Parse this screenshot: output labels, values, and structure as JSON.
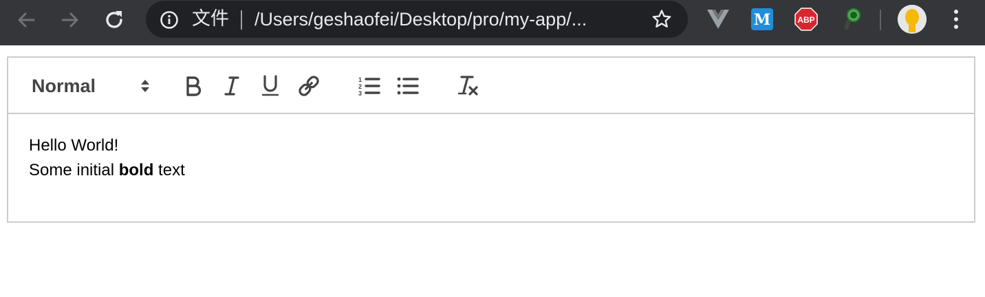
{
  "browser": {
    "page_label": "文件",
    "url": "/Users/geshaofei/Desktop/pro/my-app/...",
    "colors": {
      "toolbar": "#35363a",
      "omnibox": "#202124",
      "text": "#e8eaed"
    },
    "icons": {
      "back": "arrow-left-icon",
      "forward": "arrow-right-icon",
      "reload": "reload-icon",
      "info": "info-icon",
      "bookmark": "star-icon",
      "menu": "kebab-menu-icon"
    },
    "extensions": [
      {
        "name": "vue-devtools-icon",
        "color": "#9aa0a6"
      },
      {
        "name": "m-extension-icon",
        "label": "M",
        "color": "#1e8fd8"
      },
      {
        "name": "adblock-plus-icon",
        "label": "ABP",
        "color": "#d9262e"
      },
      {
        "name": "green-extension-icon",
        "color": "#4caf50"
      }
    ],
    "profile": {
      "name": "profile-avatar"
    }
  },
  "editor": {
    "toolbar": {
      "heading_select": {
        "value": "Normal"
      },
      "buttons": [
        {
          "name": "bold",
          "label": "B"
        },
        {
          "name": "italic",
          "label": "I"
        },
        {
          "name": "underline",
          "label": "U"
        },
        {
          "name": "link",
          "icon": "link-icon"
        },
        {
          "name": "ordered-list",
          "icon": "ordered-list-icon"
        },
        {
          "name": "bullet-list",
          "icon": "bullet-list-icon"
        },
        {
          "name": "clean",
          "label": "T",
          "icon": "clear-format-icon"
        }
      ],
      "icon_color": "#444444"
    },
    "content": {
      "line1": "Hello World!",
      "line2_prefix": "Some initial ",
      "line2_bold": "bold",
      "line2_suffix": " text"
    },
    "border_color": "#cccccc"
  }
}
